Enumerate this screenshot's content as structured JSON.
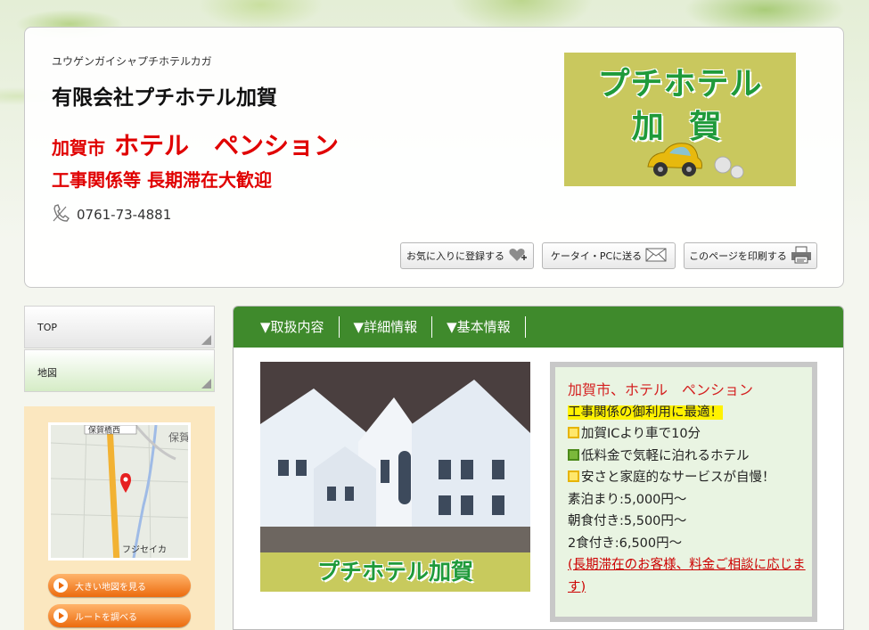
{
  "header": {
    "kana": "ユウゲンガイシャプチホテルカガ",
    "company": "有限会社プチホテル加賀",
    "catch_city": "加賀市",
    "catch_big": "ホテル　ペンション",
    "catch2": "工事関係等 長期滞在大歓迎",
    "phone": "0761-73-4881",
    "logo_line1": "プチホテル",
    "logo_line2": "加 賀"
  },
  "util_buttons": {
    "favorite": "お気に入りに登録する",
    "send": "ケータイ・PCに送る",
    "print": "このページを印刷する"
  },
  "nav": {
    "top": "TOP",
    "map": "地図"
  },
  "map_panel": {
    "label_top_left": "保賀橋西",
    "label_top_right": "保賀",
    "label_bottom": "フジセイカ",
    "big_map_button": "大きい地図を見る",
    "route_button": "ルートを調べる"
  },
  "tabs": [
    "▼取扱内容",
    "▼詳細情報",
    "▼基本情報"
  ],
  "photo": {
    "caption": "プチホテル加賀"
  },
  "info": {
    "title": "加賀市、ホテル　ペンション",
    "line1": "工事関係の御利用に最適！",
    "line2": "加賀ICより車で10分",
    "line3": "低料金で気軽に泊れるホテル",
    "line4": "安さと家庭的なサービスが自慢！",
    "line5": "素泊まり:5,000円～",
    "line6": "朝食付き:5,500円～",
    "line7": "2食付き:6,500円～",
    "line8": "(長期滞在のお客様、料金ご相談に応じます)"
  },
  "colors": {
    "accent_green": "#3f8a2c",
    "catch_red": "#e00000",
    "logo_bg": "#c9c85e",
    "map_btn_orange": "#ec6b0e"
  }
}
